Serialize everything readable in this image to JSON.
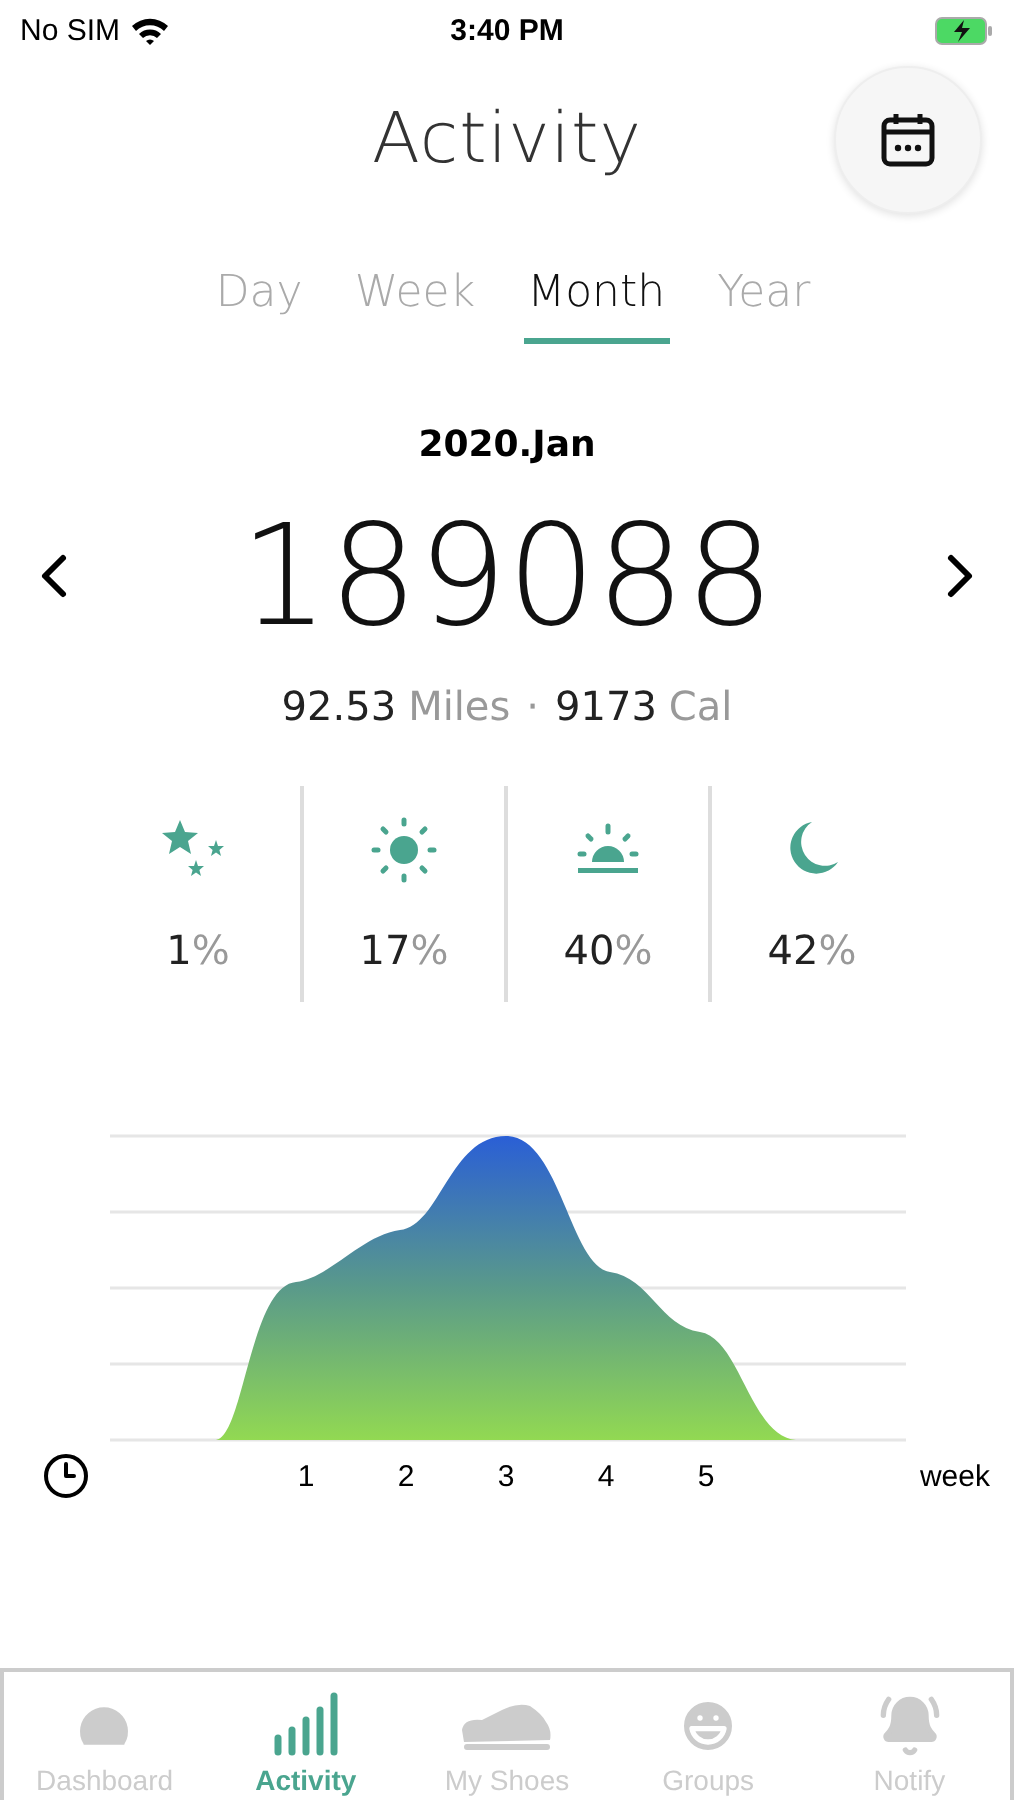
{
  "status_bar": {
    "carrier": "No SIM",
    "time": "3:40 PM"
  },
  "header": {
    "title": "Activity"
  },
  "period_tabs": [
    {
      "label": "Day",
      "selected": false
    },
    {
      "label": "Week",
      "selected": false
    },
    {
      "label": "Month",
      "selected": true
    },
    {
      "label": "Year",
      "selected": false
    }
  ],
  "period": "2020.Jan",
  "steps": "189088",
  "distance": {
    "value": "92.53",
    "unit": "Miles"
  },
  "separator": "·",
  "calories": {
    "value": "9173",
    "unit": "Cal"
  },
  "stats": [
    {
      "kind": "night",
      "value": "1",
      "unit": "%"
    },
    {
      "kind": "day",
      "value": "17",
      "unit": "%"
    },
    {
      "kind": "dawn",
      "value": "40",
      "unit": "%"
    },
    {
      "kind": "evening",
      "value": "42",
      "unit": "%"
    }
  ],
  "chart": {
    "x_labels": [
      "1",
      "2",
      "3",
      "4",
      "5"
    ],
    "x_unit": "week"
  },
  "tab_bar": [
    {
      "kind": "dashboard",
      "label": "Dashboard",
      "selected": false
    },
    {
      "kind": "activity",
      "label": "Activity",
      "selected": true
    },
    {
      "kind": "shoes",
      "label": "My Shoes",
      "selected": false
    },
    {
      "kind": "groups",
      "label": "Groups",
      "selected": false
    },
    {
      "kind": "notify",
      "label": "Notify",
      "selected": false
    }
  ]
}
